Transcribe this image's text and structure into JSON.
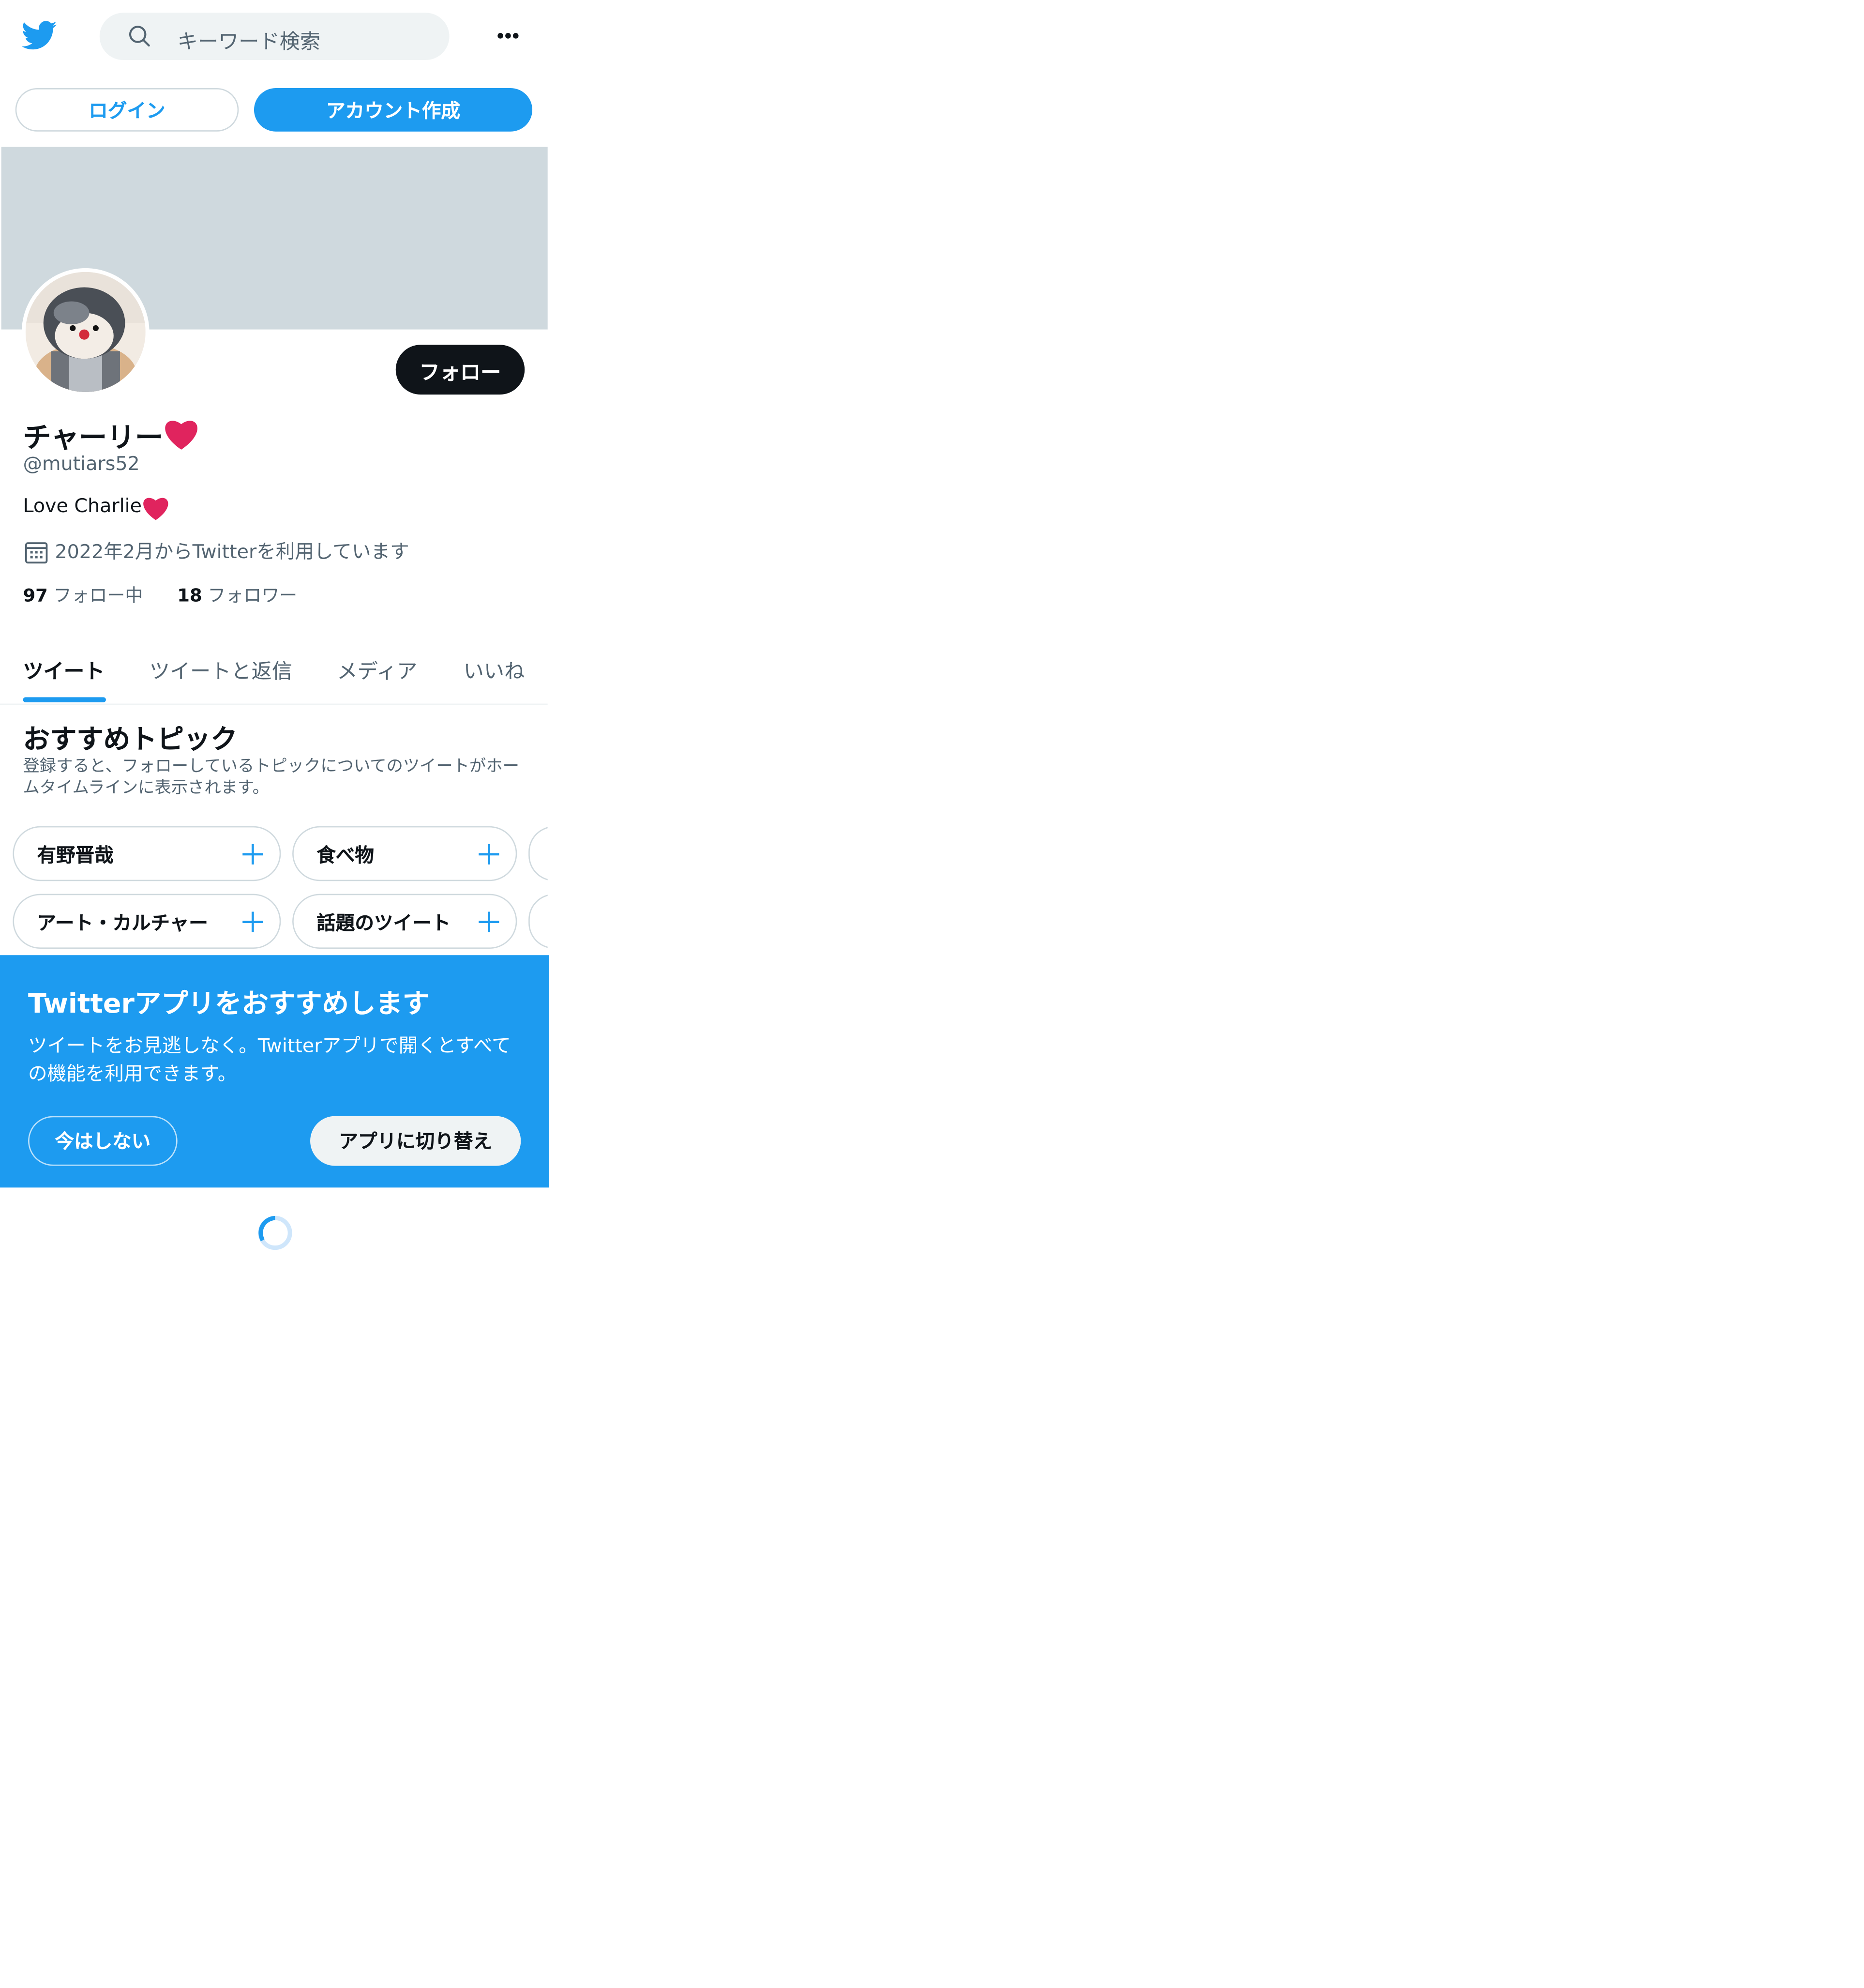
{
  "header": {
    "search_placeholder": "キーワード検索",
    "login_label": "ログイン",
    "signup_label": "アカウント作成"
  },
  "profile": {
    "display_name": "チャーリー",
    "handle": "@mutiars52",
    "bio": "Love Charlie",
    "joined": "2022年2月からTwitterを利用しています",
    "follow_label": "フォロー",
    "following_count": "97",
    "following_label": "フォロー中",
    "followers_count": "18",
    "followers_label": "フォロワー"
  },
  "tabs": [
    {
      "label": "ツイート",
      "active": true
    },
    {
      "label": "ツイートと返信",
      "active": false
    },
    {
      "label": "メディア",
      "active": false
    },
    {
      "label": "いいね",
      "active": false
    }
  ],
  "topics": {
    "title": "おすすめトピック",
    "description": "登録すると、フォローしているトピックについてのツイートがホームタイムラインに表示されます。",
    "chips": [
      {
        "label": "有野晋哉"
      },
      {
        "label": "食べ物"
      },
      {
        "label": ""
      },
      {
        "label": "アート・カルチャー"
      },
      {
        "label": "話題のツイート"
      },
      {
        "label": ""
      }
    ]
  },
  "promo": {
    "title": "Twitterアプリをおすすめします",
    "body": "ツイートをお見逃しなく。Twitterアプリで開くとすべての機能を利用できます。",
    "dismiss_label": "今はしない",
    "switch_label": "アプリに切り替え"
  },
  "icons": {
    "logo": "twitter-bird-icon",
    "search": "search-icon",
    "more": "more-horizontal-icon",
    "calendar": "calendar-icon",
    "heart": "red-heart-emoji",
    "chip_action": "plus-icon",
    "loading": "loading-spinner"
  },
  "colors": {
    "accent": "#1d9bf0",
    "text_primary": "#0f1419",
    "text_secondary": "#536471",
    "banner": "#cfd9de",
    "heart": "#e0245e"
  }
}
